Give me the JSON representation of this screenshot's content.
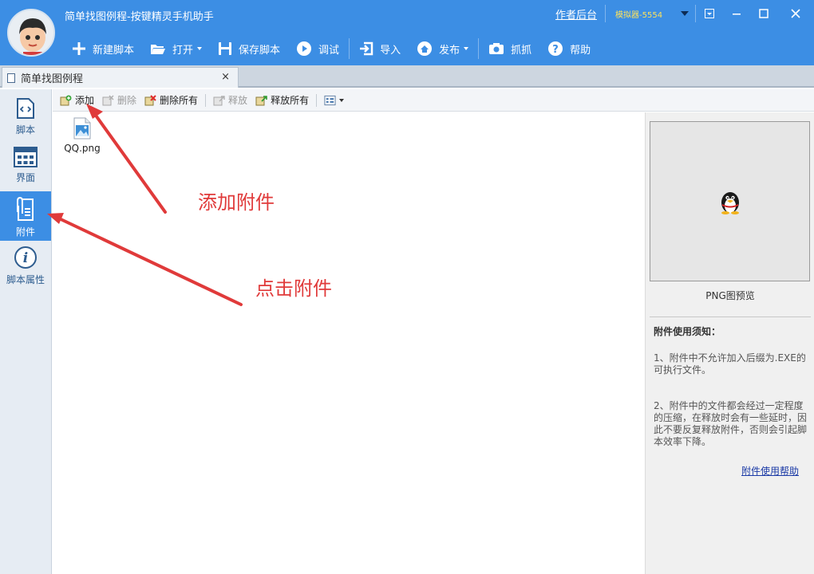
{
  "app": {
    "title": "简单找图例程-按键精灵手机助手",
    "author_link": "作者后台",
    "emulator": "模拟器-5554"
  },
  "toolbar": {
    "new_script": "新建脚本",
    "open": "打开",
    "save_script": "保存脚本",
    "debug": "调试",
    "import": "导入",
    "publish": "发布",
    "capture": "抓抓",
    "help": "帮助"
  },
  "tab": {
    "title": "简单找图例程",
    "close": "×"
  },
  "nav": [
    {
      "label": "脚本",
      "icon": "code-file-icon"
    },
    {
      "label": "界面",
      "icon": "layout-grid-icon"
    },
    {
      "label": "附件",
      "icon": "attachment-icon",
      "active": true
    },
    {
      "label": "脚本属性",
      "icon": "info-icon"
    }
  ],
  "subtoolbar": {
    "add": "添加",
    "delete": "删除",
    "delete_all": "删除所有",
    "release": "释放",
    "release_all": "释放所有"
  },
  "files": [
    {
      "name": "QQ.png",
      "icon": "image-file-icon"
    }
  ],
  "preview": {
    "label": "PNG图预览",
    "notice_title": "附件使用须知：",
    "notice_1": "1、附件中不允许加入后缀为.EXE的可执行文件。",
    "notice_2": "2、附件中的文件都会经过一定程度的压缩，在释放时会有一些延时，因此不要反复释放附件，否则会引起脚本效率下降。",
    "help_link": "附件使用帮助"
  },
  "annotations": {
    "add_attachment": "添加附件",
    "click_attachment": "点击附件"
  },
  "colors": {
    "header": "#3c8ee4",
    "active_nav": "#3c8ee4",
    "annotation": "#e03a3a",
    "emulator_text": "#ffe35a"
  }
}
